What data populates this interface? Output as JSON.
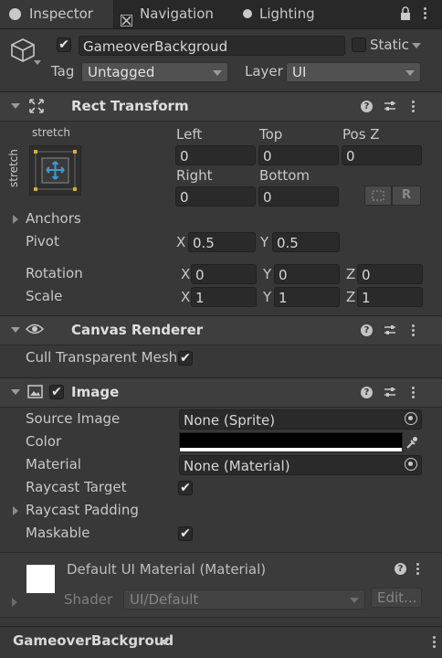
{
  "tabs": [
    {
      "label": "Inspector",
      "icon": "info-icon"
    },
    {
      "label": "Navigation",
      "icon": "navigation-icon"
    },
    {
      "label": "Lighting",
      "icon": "lightbulb-icon"
    }
  ],
  "object": {
    "name": "GameoverBackgroud",
    "static_label": "Static",
    "tag_label": "Tag",
    "tag_value": "Untagged",
    "layer_label": "Layer",
    "layer_value": "UI"
  },
  "rect_transform": {
    "title": "Rect Transform",
    "anchor_h_label": "stretch",
    "anchor_v_label": "stretch",
    "left_label": "Left",
    "left_value": "0",
    "top_label": "Top",
    "top_value": "0",
    "posz_label": "Pos Z",
    "posz_value": "0",
    "right_label": "Right",
    "right_value": "0",
    "bottom_label": "Bottom",
    "bottom_value": "0",
    "blueprint_btn": "R",
    "anchors_label": "Anchors",
    "pivot_label": "Pivot",
    "pivot_x": "0.5",
    "pivot_y": "0.5",
    "rotation_label": "Rotation",
    "rot_x": "0",
    "rot_y": "0",
    "rot_z": "0",
    "scale_label": "Scale",
    "scale_x": "1",
    "scale_y": "1",
    "scale_z": "1",
    "x": "X",
    "y": "Y",
    "z": "Z"
  },
  "canvas_renderer": {
    "title": "Canvas Renderer",
    "cull_label": "Cull Transparent Mesh"
  },
  "image": {
    "title": "Image",
    "source_label": "Source Image",
    "source_value": "None (Sprite)",
    "color_label": "Color",
    "material_label": "Material",
    "material_value": "None (Material)",
    "raycast_target_label": "Raycast Target",
    "raycast_padding_label": "Raycast Padding",
    "maskable_label": "Maskable",
    "color_value": "#000000"
  },
  "material_preview": {
    "title": "Default UI Material (Material)",
    "shader_label": "Shader",
    "shader_value": "UI/Default",
    "edit_label": "Edit..."
  },
  "footer": {
    "object_name": "GameoverBackgroud"
  }
}
